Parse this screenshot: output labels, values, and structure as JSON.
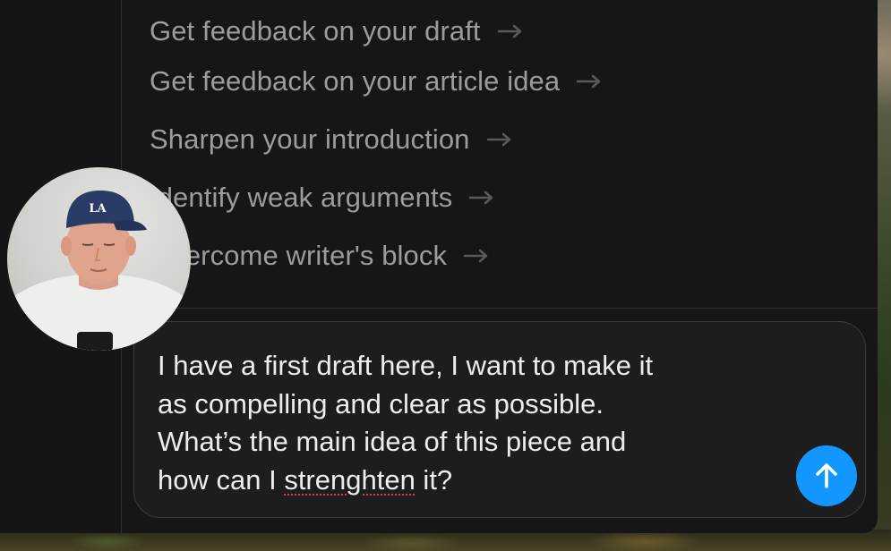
{
  "suggestions": [
    {
      "label": "Get feedback on your draft"
    },
    {
      "label": "Get feedback on your article idea"
    },
    {
      "label": "Sharpen your introduction"
    },
    {
      "label": "Identify weak arguments"
    },
    {
      "label": "Overcome writer's block"
    }
  ],
  "composer": {
    "text_before": "I have a first draft here, I want to make it\nas compelling and clear as possible.\nWhat’s the main idea of this piece and\nhow can I ",
    "misspelled_word": "strenghten",
    "text_after": " it?"
  },
  "send_button": {
    "icon": "arrow-up-icon",
    "color": "#1496ff"
  },
  "webcam": {
    "cap_logo": "LA"
  },
  "colors": {
    "panel": "#161616",
    "composer_bg": "#1d1d1d",
    "suggestion_text": "#9c9c9c",
    "composer_text": "#ededed",
    "accent": "#1496ff"
  }
}
